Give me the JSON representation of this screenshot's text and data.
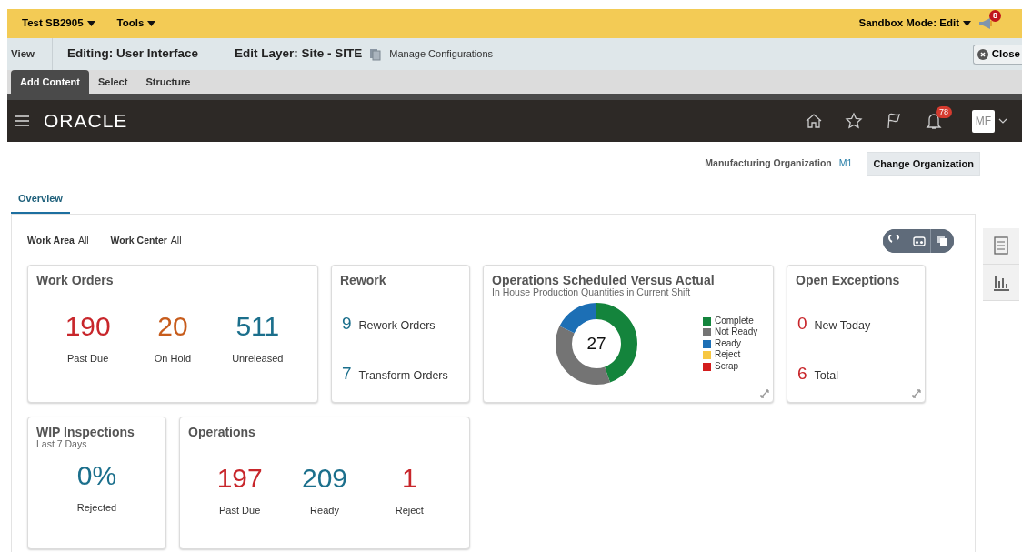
{
  "sandbox_bar": {
    "menus": [
      {
        "label": "Test SB2905"
      },
      {
        "label": "Tools"
      }
    ],
    "mode": "Sandbox Mode: Edit",
    "notification_count": "8"
  },
  "editor_bar": {
    "view": "View",
    "editing": "Editing: User Interface",
    "edit_layer": "Edit Layer: Site - SITE",
    "manage": "Manage Configurations",
    "close": "Close"
  },
  "editor_tabs": [
    {
      "label": "Add Content",
      "selected": true
    },
    {
      "label": "Select",
      "selected": false
    },
    {
      "label": "Structure",
      "selected": false
    }
  ],
  "header": {
    "brand": "ORACLE",
    "notification_count": "78",
    "user_initials": "MF"
  },
  "organization": {
    "label": "Manufacturing Organization",
    "value": "M1",
    "button": "Change Organization"
  },
  "page_tabs": [
    {
      "label": "Overview",
      "selected": true
    }
  ],
  "filters": [
    {
      "label": "Work Area",
      "value": "All"
    },
    {
      "label": "Work Center",
      "value": "All"
    }
  ],
  "cards": [
    {
      "kind": "metrics",
      "title": "Work Orders",
      "metrics": [
        {
          "value": "190",
          "label": "Past Due",
          "color": "#c8262b"
        },
        {
          "value": "20",
          "label": "On Hold",
          "color": "#c75c1c"
        },
        {
          "value": "511",
          "label": "Unreleased",
          "color": "#1b6f8c"
        }
      ]
    },
    {
      "kind": "list",
      "title": "Rework",
      "items": [
        {
          "value": "9",
          "label": "Rework Orders",
          "color": "#1b6f8c"
        },
        {
          "value": "7",
          "label": "Transform Orders",
          "color": "#1b6f8c"
        }
      ]
    },
    {
      "kind": "donut",
      "title": "Operations Scheduled Versus Actual",
      "subtitle": "In House Production Quantities in Current Shift",
      "center": "27",
      "expandable": true,
      "legend": [
        {
          "label": "Complete",
          "color": "#14843c"
        },
        {
          "label": "Not Ready",
          "color": "#747474"
        },
        {
          "label": "Ready",
          "color": "#1c6fb5"
        },
        {
          "label": "Reject",
          "color": "#f7c742"
        },
        {
          "label": "Scrap",
          "color": "#d31d1d"
        }
      ]
    },
    {
      "kind": "list",
      "title": "Open Exceptions",
      "expandable": true,
      "items": [
        {
          "value": "0",
          "label": "New Today",
          "color": "#c8262b"
        },
        {
          "value": "6",
          "label": "Total",
          "color": "#c8262b"
        }
      ]
    },
    {
      "kind": "metrics",
      "title": "WIP Inspections",
      "subtitle": "Last 7 Days",
      "metrics": [
        {
          "value": "0%",
          "label": "Rejected",
          "color": "#1b6f8c"
        }
      ]
    },
    {
      "kind": "metrics",
      "title": "Operations",
      "metrics": [
        {
          "value": "197",
          "label": "Past Due",
          "color": "#c8262b"
        },
        {
          "value": "209",
          "label": "Ready",
          "color": "#1b6f8c"
        },
        {
          "value": "1",
          "label": "Reject",
          "color": "#c8262b"
        }
      ]
    }
  ]
}
